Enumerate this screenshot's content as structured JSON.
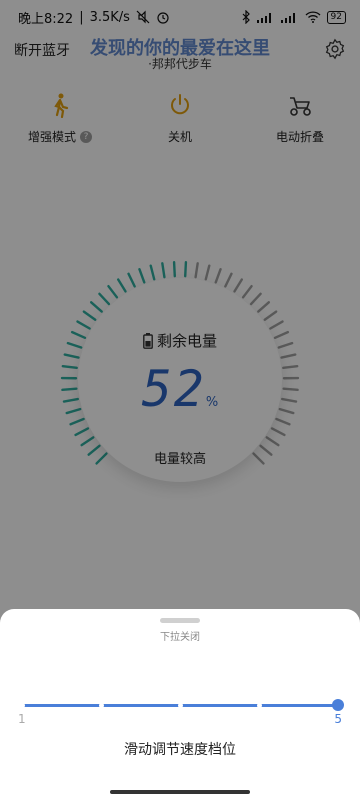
{
  "status_bar": {
    "time": "晚上8:22",
    "speed": "3.5K/s",
    "battery": "92"
  },
  "header": {
    "disconnect_label": "断开蓝牙",
    "title": "发现的你的最爱在这里",
    "subtitle": "·邦邦代步车"
  },
  "actions": [
    {
      "label": "增强模式",
      "icon": "walking-person-icon"
    },
    {
      "label": "关机",
      "icon": "power-icon"
    },
    {
      "label": "电动折叠",
      "icon": "folding-scooter-icon"
    }
  ],
  "battery_gauge": {
    "label": "剩余电量",
    "percent_value": 52,
    "percent": "52",
    "percent_sign": "%",
    "level_text": "电量较高",
    "active_color": "#2ea89a",
    "inactive_color": "#9a9a9a"
  },
  "bottom_sheet": {
    "pull_text": "下拉关闭",
    "slider_min": "1",
    "slider_max": "5",
    "slider_value": 5,
    "caption": "滑动调节速度档位",
    "accent": "#4a7fd9"
  }
}
